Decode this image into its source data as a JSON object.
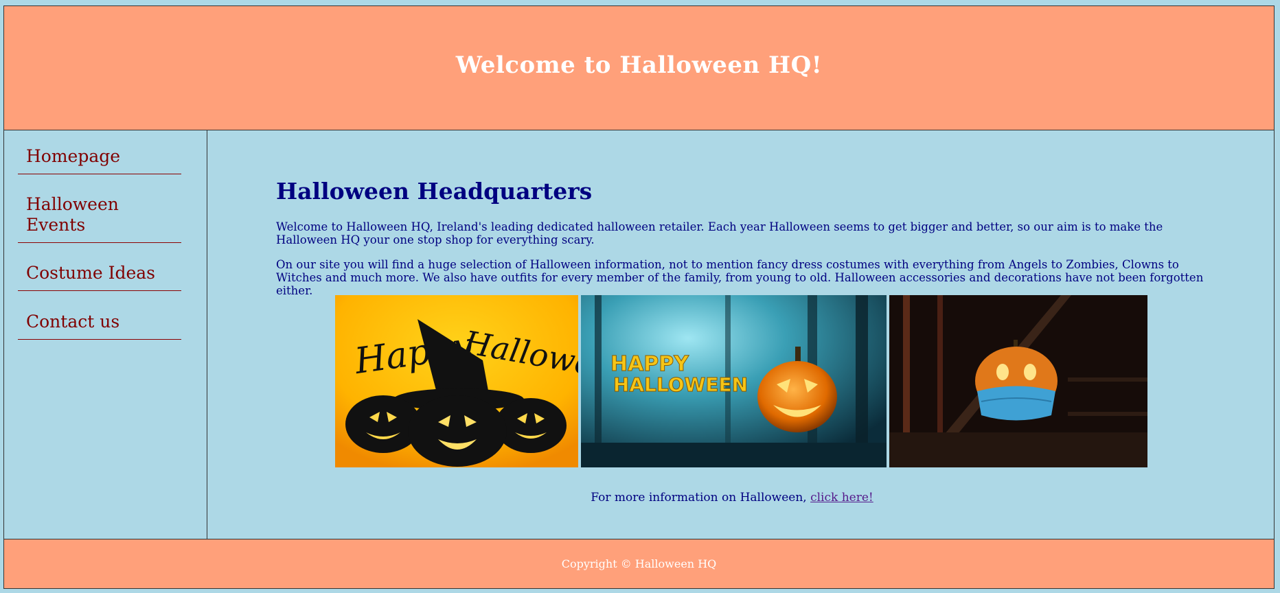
{
  "header": {
    "title": "Welcome to Halloween HQ!"
  },
  "nav": {
    "items": [
      {
        "label": "Homepage"
      },
      {
        "label": "Halloween Events"
      },
      {
        "label": "Costume Ideas"
      },
      {
        "label": "Contact us"
      }
    ]
  },
  "main": {
    "title": "Halloween Headquarters",
    "paragraph1": "Welcome to Halloween HQ, Ireland's leading dedicated halloween retailer. Each year Halloween seems to get bigger and better, so our aim is to make the Halloween HQ your one stop shop for everything scary.",
    "paragraph2": "On our site you will find a huge selection of Halloween information, not to mention fancy dress costumes with everything from Angels to Zombies, Clowns to Witches and much more. We also have outfits for every member of the family, from young to old. Halloween accessories and decorations have not been forgotten either.",
    "images": [
      {
        "name": "happy-halloween-pumpkins-image",
        "text_top": "Happy",
        "text_right": "Halloween"
      },
      {
        "name": "haunted-forest-pumpkin-image",
        "text_line1": "HAPPY",
        "text_line2": "HALLOWEEN"
      },
      {
        "name": "masked-pumpkin-image"
      }
    ],
    "more_info_text": "For more information on Halloween, ",
    "more_info_link": "click here!"
  },
  "footer": {
    "copyright": "Copyright © Halloween HQ"
  },
  "colors": {
    "background": "#add8e6",
    "banner": "#ffa07a",
    "heading": "#000080",
    "nav_link": "#800000",
    "visited_link": "#551a8b"
  }
}
